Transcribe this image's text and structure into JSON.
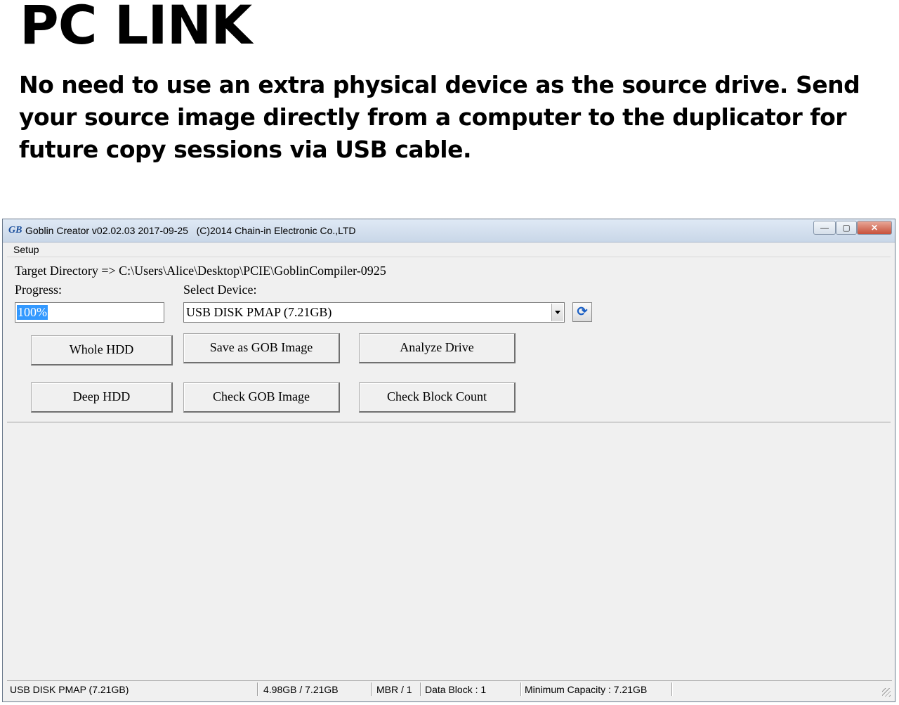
{
  "slide": {
    "heading": "PC LINK",
    "description": "No need to use an extra physical device as the source drive. Send your source image directly from a computer to the duplicator for future copy sessions via USB cable."
  },
  "window": {
    "title": "Goblin Creator v02.02.03 2017-09-25   (C)2014 Chain-in Electronic Co.,LTD",
    "app_icon_text": "GB",
    "controls": {
      "minimize": "—",
      "maximize": "▢",
      "close": "✕"
    }
  },
  "menu": {
    "setup": "Setup"
  },
  "main": {
    "target_directory": "Target Directory => C:\\Users\\Alice\\Desktop\\PCIE\\GoblinCompiler-0925",
    "progress_label": "Progress:",
    "progress_value": "100%",
    "select_device_label": "Select Device:",
    "selected_device": "USB DISK PMAP (7.21GB)",
    "refresh_icon": "refresh-icon"
  },
  "buttons": {
    "whole_hdd": "Whole HDD",
    "save_gob": "Save as GOB Image",
    "analyze_drive": "Analyze Drive",
    "deep_hdd": "Deep HDD",
    "check_gob": "Check GOB Image",
    "check_block": "Check Block Count"
  },
  "status": {
    "device": "USB DISK PMAP (7.21GB)",
    "usage": "4.98GB / 7.21GB",
    "partition": "MBR / 1",
    "data_block": "Data Block : 1",
    "min_capacity": "Minimum Capacity : 7.21GB"
  }
}
